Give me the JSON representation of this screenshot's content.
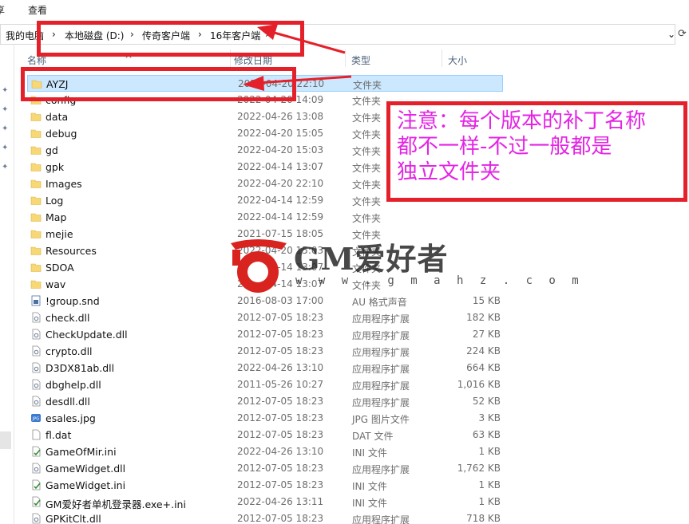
{
  "menu": {
    "left_partial": "享",
    "view": "查看"
  },
  "address": {
    "crumbs": [
      "我的电脑",
      "本地磁盘 (D:)",
      "传奇客户端",
      "16年客户端"
    ],
    "drop_glyph": "⌄",
    "refresh_glyph": "⟳"
  },
  "columns": {
    "name": "名称",
    "date": "修改日期",
    "type": "类型",
    "size": "大小"
  },
  "files": [
    {
      "name": "AYZJ",
      "date": "2022-04-20 22:10",
      "type": "文件夹",
      "size": "",
      "icon": "folder-icon",
      "selected": true
    },
    {
      "name": "config",
      "date": "2022-04-20 14:09",
      "type": "文件夹",
      "size": "",
      "icon": "folder-icon"
    },
    {
      "name": "data",
      "date": "2022-04-26 13:08",
      "type": "文件夹",
      "size": "",
      "icon": "folder-icon"
    },
    {
      "name": "debug",
      "date": "2022-04-20 15:05",
      "type": "文件夹",
      "size": "",
      "icon": "folder-icon"
    },
    {
      "name": "gd",
      "date": "2022-04-20 15:03",
      "type": "文件夹",
      "size": "",
      "icon": "folder-icon"
    },
    {
      "name": "gpk",
      "date": "2022-04-14 13:07",
      "type": "文件夹",
      "size": "",
      "icon": "folder-icon"
    },
    {
      "name": "Images",
      "date": "2022-04-20 22:10",
      "type": "文件夹",
      "size": "",
      "icon": "folder-icon"
    },
    {
      "name": "Log",
      "date": "2022-04-14 12:59",
      "type": "文件夹",
      "size": "",
      "icon": "folder-icon"
    },
    {
      "name": "Map",
      "date": "2022-04-14 12:59",
      "type": "文件夹",
      "size": "",
      "icon": "folder-icon"
    },
    {
      "name": "mejie",
      "date": "2021-07-15 18:05",
      "type": "文件夹",
      "size": "",
      "icon": "folder-icon"
    },
    {
      "name": "Resources",
      "date": "2022-04-20 15:03",
      "type": "文件夹",
      "size": "",
      "icon": "folder-icon"
    },
    {
      "name": "SDOA",
      "date": "2022-04-14 13:07",
      "type": "文件夹",
      "size": "",
      "icon": "folder-icon"
    },
    {
      "name": "wav",
      "date": "2022-04-14 13:07",
      "type": "文件夹",
      "size": "",
      "icon": "folder-icon"
    },
    {
      "name": "!group.snd",
      "date": "2016-08-03 17:00",
      "type": "AU 格式声音",
      "size": "15 KB",
      "icon": "audio-file-icon"
    },
    {
      "name": "check.dll",
      "date": "2012-07-05 18:23",
      "type": "应用程序扩展",
      "size": "182 KB",
      "icon": "dll-file-icon"
    },
    {
      "name": "CheckUpdate.dll",
      "date": "2012-07-05 18:23",
      "type": "应用程序扩展",
      "size": "27 KB",
      "icon": "dll-file-icon"
    },
    {
      "name": "crypto.dll",
      "date": "2012-07-05 18:23",
      "type": "应用程序扩展",
      "size": "224 KB",
      "icon": "dll-file-icon"
    },
    {
      "name": "D3DX81ab.dll",
      "date": "2022-04-26 13:10",
      "type": "应用程序扩展",
      "size": "664 KB",
      "icon": "dll-file-icon"
    },
    {
      "name": "dbghelp.dll",
      "date": "2011-05-26 10:27",
      "type": "应用程序扩展",
      "size": "1,016 KB",
      "icon": "dll-file-icon"
    },
    {
      "name": "desdll.dll",
      "date": "2012-07-05 18:23",
      "type": "应用程序扩展",
      "size": "52 KB",
      "icon": "dll-file-icon"
    },
    {
      "name": "esales.jpg",
      "date": "2012-07-05 18:23",
      "type": "JPG 图片文件",
      "size": "3 KB",
      "icon": "jpg-file-icon"
    },
    {
      "name": "fl.dat",
      "date": "2012-07-05 18:23",
      "type": "DAT 文件",
      "size": "63 KB",
      "icon": "blank-file-icon"
    },
    {
      "name": "GameOfMir.ini",
      "date": "2022-04-26 13:10",
      "type": "INI 文件",
      "size": "1 KB",
      "icon": "ini-file-icon"
    },
    {
      "name": "GameWidget.dll",
      "date": "2012-07-05 18:23",
      "type": "应用程序扩展",
      "size": "1,762 KB",
      "icon": "dll-file-icon"
    },
    {
      "name": "GameWidget.ini",
      "date": "2012-07-05 18:23",
      "type": "INI 文件",
      "size": "1 KB",
      "icon": "ini-file-icon"
    },
    {
      "name": "GM爱好者单机登录器.exe+.ini",
      "date": "2022-04-26 13:11",
      "type": "INI 文件",
      "size": "1 KB",
      "icon": "ini-file-icon"
    },
    {
      "name": "GPKitClt.dll",
      "date": "2012-07-05 18:23",
      "type": "应用程序扩展",
      "size": "718 KB",
      "icon": "dll-file-icon"
    }
  ],
  "annotation": {
    "lines": [
      "注意：每个版本的补丁名称",
      "都不一样-不过一般都是",
      "独立文件夹"
    ],
    "color": "#e424e4",
    "box_color": "#e4212a"
  },
  "watermark": {
    "title": "GM爱好者",
    "url": "w w w . g m a h z . c o m",
    "logo_color": "#d8231f"
  },
  "colors": {
    "selection": "#cce8ff",
    "selection_border": "#99d1ff",
    "folder": "#f8d775"
  }
}
